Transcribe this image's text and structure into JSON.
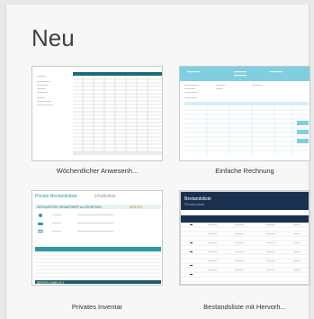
{
  "page": {
    "title": "Neu"
  },
  "templates": [
    {
      "caption": "Wöchentlicher Anwesenh..."
    },
    {
      "caption": "Einfache Rechnung"
    },
    {
      "caption": "Privates Inventar",
      "preview": {
        "heading": "Private Bestandsliste",
        "heading_sub": "Inhaltsliste",
        "total_label": "GESCHÄTZTER GESAMTWERT ALLER ARTIKEL:",
        "total_value": "€198,00 €",
        "footer_label": "BEISPIELTABELLE 1"
      }
    },
    {
      "caption": "Bestandsliste mit Hervorh...",
      "preview": {
        "heading": "Bestandsliste",
        "subheading": "Firmenname"
      }
    }
  ],
  "colors": {
    "accent_teal": "#2e9aa0",
    "invoice_blue": "#7fcfe0",
    "dark_navy": "#1b2f4f",
    "green_band": "#2f7d6a"
  }
}
